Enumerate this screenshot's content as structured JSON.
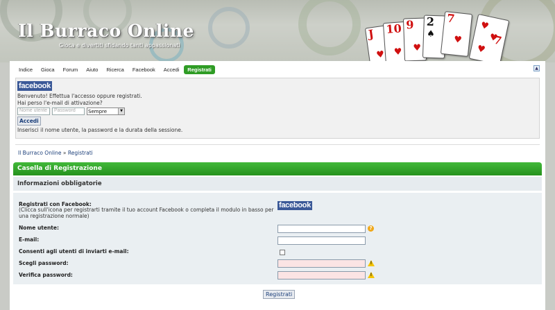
{
  "header": {
    "title": "Il Burraco Online",
    "tagline": "Gioca e divertiti sfidando tanti appassionati",
    "cards": [
      {
        "rank": "J",
        "suit": "♥",
        "color": "red"
      },
      {
        "rank": "10",
        "suit": "♥",
        "color": "red"
      },
      {
        "rank": "9",
        "suit": "♥",
        "color": "red"
      },
      {
        "rank": "2",
        "suit": "♠",
        "color": "black"
      },
      {
        "rank": "7",
        "suit": "♥",
        "color": "red"
      },
      {
        "rank": "7",
        "suit": "♥",
        "color": "red"
      }
    ]
  },
  "nav": {
    "items": [
      "Indice",
      "Gioca",
      "Forum",
      "Aiuto",
      "Ricerca",
      "Facebook",
      "Accedi",
      "Registrati"
    ],
    "active_index": 7,
    "collapse_symbol": "▲"
  },
  "login": {
    "fb_logo": "facebook",
    "welcome_line1": "Benvenuto! Effettua l'accesso oppure registrati.",
    "welcome_line2": "Hai perso l'e-mail di attivazione?",
    "username_placeholder": "Nome utente",
    "password_placeholder": "Password",
    "duration_value": "Sempre",
    "login_button": "Accedi",
    "hint": "Inserisci il nome utente, la password e la durata della sessione."
  },
  "breadcrumb": {
    "home": "Il Burraco Online",
    "separator": " » ",
    "current": "Registrati"
  },
  "registration": {
    "header": "Casella di Registrazione",
    "section_title": "Informazioni obbligatorie",
    "fb_label": "Registrati con Facebook:",
    "fb_sub": "(Clicca sull'icona per registrarti tramite il tuo account Facebook o completa il modulo in basso per una registrazione normale)",
    "fb_logo": "facebook",
    "fields": {
      "username": "Nome utente:",
      "email": "E-mail:",
      "allow_email": "Consenti agli utenti di inviarti e-mail:",
      "password": "Scegli password:",
      "verify_password": "Verifica password:"
    },
    "submit": "Registrati"
  },
  "colors": {
    "accent_green": "#2f9c25",
    "facebook_blue": "#3b5998",
    "field_warning_pink": "#fbe4e4"
  }
}
